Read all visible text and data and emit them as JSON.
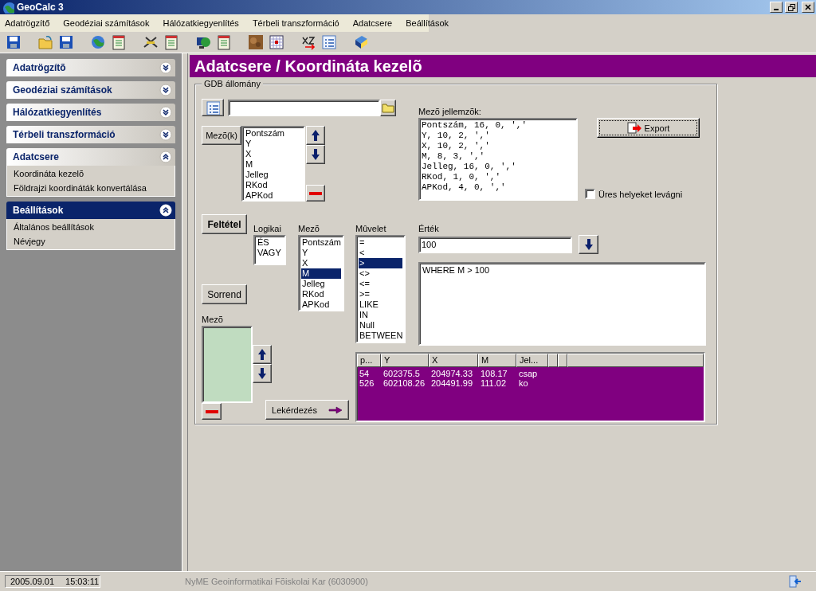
{
  "window": {
    "title": "GeoCalc 3"
  },
  "menu": [
    "Adatrögzítő",
    "Geodéziai számítások",
    "Hálózatkiegyenlítés",
    "Térbeli transzformáció",
    "Adatcsere",
    "Beállítások"
  ],
  "sidebar": [
    {
      "title": "Adatrögzítõ",
      "expanded": false,
      "selected": false
    },
    {
      "title": "Geodéziai számítások",
      "expanded": false,
      "selected": false
    },
    {
      "title": "Hálózatkiegyenlítés",
      "expanded": false,
      "selected": false
    },
    {
      "title": "Térbeli transzformáció",
      "expanded": false,
      "selected": false
    },
    {
      "title": "Adatcsere",
      "expanded": true,
      "selected": false,
      "items": [
        "Koordináta kezelõ",
        "Földrajzi koordináták  konvertálása"
      ]
    },
    {
      "title": "Beállítások",
      "expanded": true,
      "selected": true,
      "items": [
        "Általános beállítások",
        "Névjegy"
      ]
    }
  ],
  "page_title": "Adatcsere / Koordináta kezelõ",
  "group_title": "GDB állomány",
  "fields_button": "Mezõ(k)",
  "fields_list": [
    {
      "label": "Pontszám",
      "selected": false
    },
    {
      "label": "Y",
      "selected": false
    },
    {
      "label": "X",
      "selected": false
    },
    {
      "label": "M",
      "selected": false
    },
    {
      "label": "Jelleg",
      "selected": false
    },
    {
      "label": "RKod",
      "selected": false
    },
    {
      "label": "APKod",
      "selected": false
    }
  ],
  "field_props_label": "Mezõ jellemzõk:",
  "field_props": [
    "Pontszám, 16, 0, ','",
    "Y, 10, 2, ','",
    "X, 10, 2, ','",
    "M, 8, 3, ','",
    "Jelleg, 16, 0, ','",
    "RKod, 1, 0, ','",
    "APKod, 4, 0, ','"
  ],
  "export_button": "Export",
  "trim_checkbox": {
    "label": "Üres helyeket levágni",
    "checked": false
  },
  "condition_button": "Feltétel",
  "logic": {
    "label": "Logikai",
    "items": [
      {
        "label": "ÉS",
        "selected": false
      },
      {
        "label": "VAGY",
        "selected": false
      }
    ]
  },
  "field": {
    "label": "Mezõ",
    "items": [
      {
        "label": "Pontszám",
        "selected": false
      },
      {
        "label": "Y",
        "selected": false
      },
      {
        "label": "X",
        "selected": false
      },
      {
        "label": "M",
        "selected": true
      },
      {
        "label": "Jelleg",
        "selected": false
      },
      {
        "label": "RKod",
        "selected": false
      },
      {
        "label": "APKod",
        "selected": false
      }
    ]
  },
  "operation": {
    "label": "Mûvelet",
    "items": [
      {
        "label": "=",
        "selected": false
      },
      {
        "label": "<",
        "selected": false
      },
      {
        "label": ">",
        "selected": true
      },
      {
        "label": "<>",
        "selected": false
      },
      {
        "label": "<=",
        "selected": false
      },
      {
        "label": ">=",
        "selected": false
      },
      {
        "label": "LIKE",
        "selected": false
      },
      {
        "label": "IN",
        "selected": false
      },
      {
        "label": "Null",
        "selected": false
      },
      {
        "label": "BETWEEN",
        "selected": false
      }
    ]
  },
  "value": {
    "label": "Érték",
    "value": "100"
  },
  "query_text": "WHERE M > 100",
  "order_button": "Sorrend",
  "order_field_label": "Mezõ",
  "query_button": "Lekérdezés",
  "table": {
    "columns": [
      "p...",
      "Y",
      "X",
      "M",
      "Jel..."
    ],
    "rows": [
      [
        "54",
        "602375.5",
        "204974.33",
        "108.17",
        "csap"
      ],
      [
        "526",
        "602108.26",
        "204491.99",
        "111.02",
        "ko"
      ]
    ]
  },
  "status_bar": {
    "date": "2005.09.01",
    "time": "15:03:11",
    "text": "NyME Geoinformatikai Fõiskolai Kar (6030900)"
  }
}
